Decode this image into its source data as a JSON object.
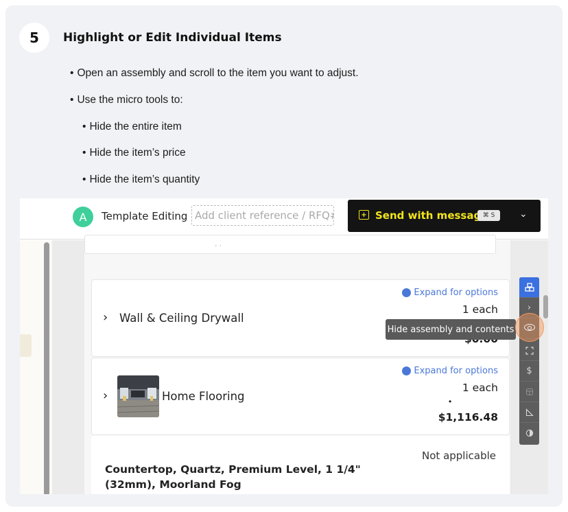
{
  "step": {
    "number": "5",
    "title": "Highlight or Edit Individual Items",
    "bullets": [
      "Open an assembly and scroll to the item you want to adjust.",
      "Use the micro tools to:",
      "Hide the entire item",
      "Hide the item’s price",
      "Hide the item’s quantity"
    ]
  },
  "topbar": {
    "avatar_letter": "A",
    "template_label": "Template Editing",
    "client_ref_placeholder": "Add client reference / RFQ#",
    "send_label": "Send with message",
    "shortcut": "⌘ S"
  },
  "items": [
    {
      "name": "Wall & Ceiling Drywall",
      "expand": "Expand for options",
      "qty": "1 each",
      "sep": "•",
      "price": "$0.00"
    },
    {
      "name": "Home Flooring",
      "expand": "Expand for options",
      "qty": "1 each",
      "sep": "•",
      "price": "$1,116.48"
    },
    {
      "name": "Countertop, Quartz, Premium Level, 1 1/4\" (32mm), Moorland Fog",
      "status": "Not applicable"
    }
  ],
  "tooltip": "Hide assembly and contents",
  "colors": {
    "accent": "#f2e51b",
    "link": "#4a78d8",
    "tool_active": "#3a70e0",
    "avatar": "#3ecf9a"
  },
  "icons": [
    "assembly-icon",
    "chevron-right-icon",
    "eye-icon",
    "expand-icon",
    "dollar-icon",
    "box-icon",
    "ruler-icon",
    "contrast-icon"
  ]
}
